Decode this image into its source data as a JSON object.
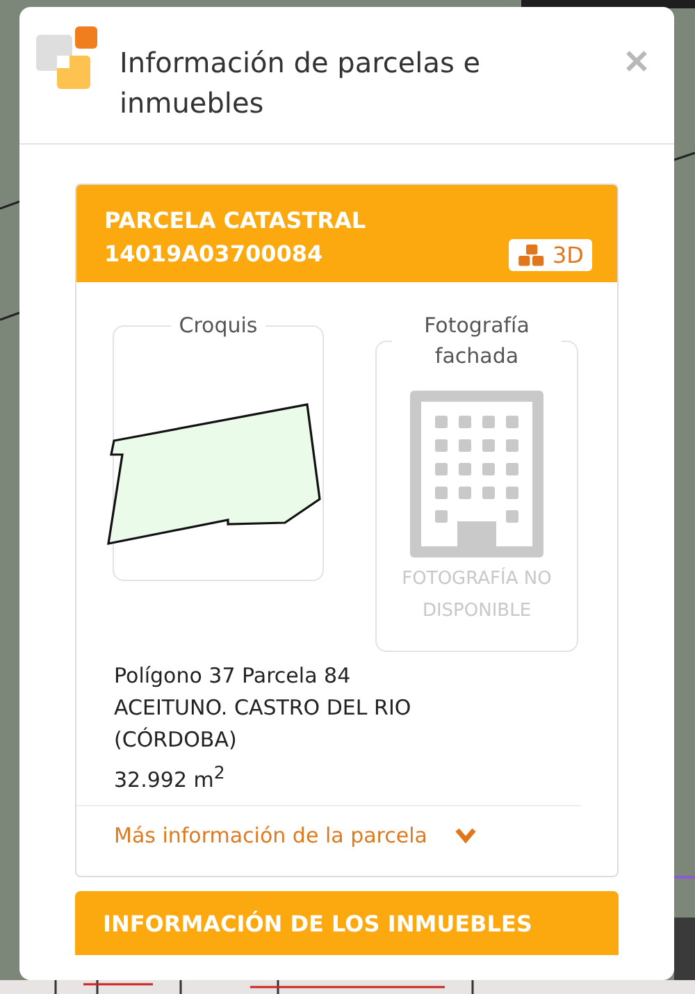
{
  "dialog": {
    "title": "Información de parcelas e inmuebles"
  },
  "parcel": {
    "heading": "PARCELA CATASTRAL",
    "reference": "14019A03700084",
    "view_3d_button": "3D",
    "sketch": {
      "label": "Croquis"
    },
    "photo": {
      "label": "Fotografía fachada",
      "status": "FOTOGRAFÍA NO DISPONIBLE"
    },
    "address_lines": [
      "Polígono 37 Parcela 84",
      "ACEITUNO. CASTRO DEL RIO",
      "(CÓRDOBA)",
      "32.992 m$^{2}$"
    ],
    "more_info": {
      "label": "Más información de la parcela",
      "expanded": false
    }
  },
  "buildings": {
    "heading": "INFORMACIÓN DE LOS INMUEBLES"
  }
}
